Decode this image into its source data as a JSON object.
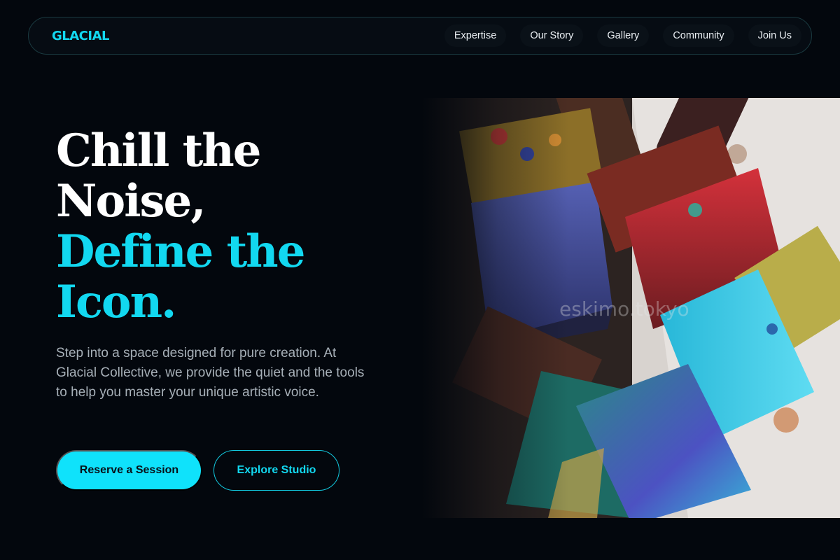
{
  "brand": {
    "logo": "GLACIAL"
  },
  "nav": {
    "links": [
      "Expertise",
      "Our Story",
      "Gallery",
      "Community",
      "Join Us"
    ]
  },
  "hero": {
    "title_lines": [
      "Chill the",
      "Noise,"
    ],
    "accent_lines": [
      "Define the",
      "Icon."
    ],
    "description": "Step into a space designed for pure creation. At Glacial Collective, we provide the quiet and the tools to help you master your unique artistic voice.",
    "primary_cta": "Reserve a Session",
    "secondary_cta": "Explore Studio"
  },
  "image": {
    "watermark": "eskimo.tokyo"
  },
  "colors": {
    "background": "#03070d",
    "accent": "#12d8f0",
    "text": "#ffffff",
    "muted": "#a7b0b8"
  }
}
